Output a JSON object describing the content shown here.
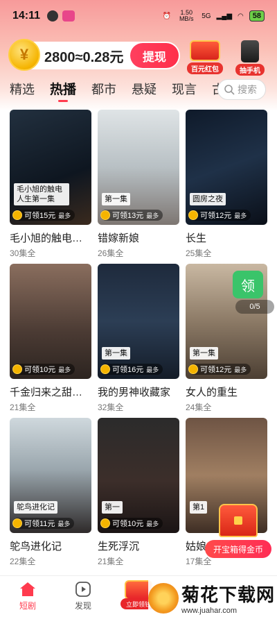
{
  "status": {
    "time": "14:11",
    "net_speed": "1.50 MB/s",
    "signal": "5G",
    "battery": "58"
  },
  "wallet": {
    "amount": "2800≈0.28元",
    "coin_glyph": "¥",
    "cash_button": "提现"
  },
  "promos": [
    {
      "label": "百元红包"
    },
    {
      "label": "抽手机"
    }
  ],
  "tabs": [
    "精选",
    "热播",
    "都市",
    "悬疑",
    "现言",
    "古"
  ],
  "active_tab": "热播",
  "search": {
    "placeholder": "搜索"
  },
  "shows": [
    {
      "title": "毛小旭的触电…",
      "episodes": "30集全",
      "reward": "可领15元",
      "caption": "毛小旭的触电人生第一集",
      "most": "最多"
    },
    {
      "title": "错嫁新娘",
      "episodes": "26集全",
      "reward": "可领13元",
      "caption": "第一集",
      "most": "最多"
    },
    {
      "title": "长生",
      "episodes": "25集全",
      "reward": "可领12元",
      "caption": "圆房之夜",
      "most": "最多"
    },
    {
      "title": "千金归来之甜…",
      "episodes": "21集全",
      "reward": "可领10元",
      "caption": "",
      "most": "最多"
    },
    {
      "title": "我的男神收藏家",
      "episodes": "32集全",
      "reward": "可领16元",
      "caption": "第一集",
      "most": "最多"
    },
    {
      "title": "女人的重生",
      "episodes": "24集全",
      "reward": "可领12元",
      "caption": "第一集",
      "most": "最多"
    },
    {
      "title": "鸵鸟进化记",
      "episodes": "22集全",
      "reward": "可领11元",
      "caption": "鸵鸟进化记",
      "most": "最多"
    },
    {
      "title": "生死浮沉",
      "episodes": "21集全",
      "reward": "可领10元",
      "caption": "第一",
      "most": "最多"
    },
    {
      "title": "姑娘…",
      "episodes": "17集全",
      "reward": "",
      "caption": "第1",
      "most": ""
    }
  ],
  "pager": "0/5",
  "pager_icon": "领",
  "treasure": {
    "button": "开宝箱得金币"
  },
  "bottom_nav": [
    {
      "label": "短剧"
    },
    {
      "label": "发现"
    }
  ],
  "center_nav": {
    "label": "立即领钱"
  },
  "watermark": {
    "name": "菊花下载网",
    "url": "www.juahar.com"
  }
}
